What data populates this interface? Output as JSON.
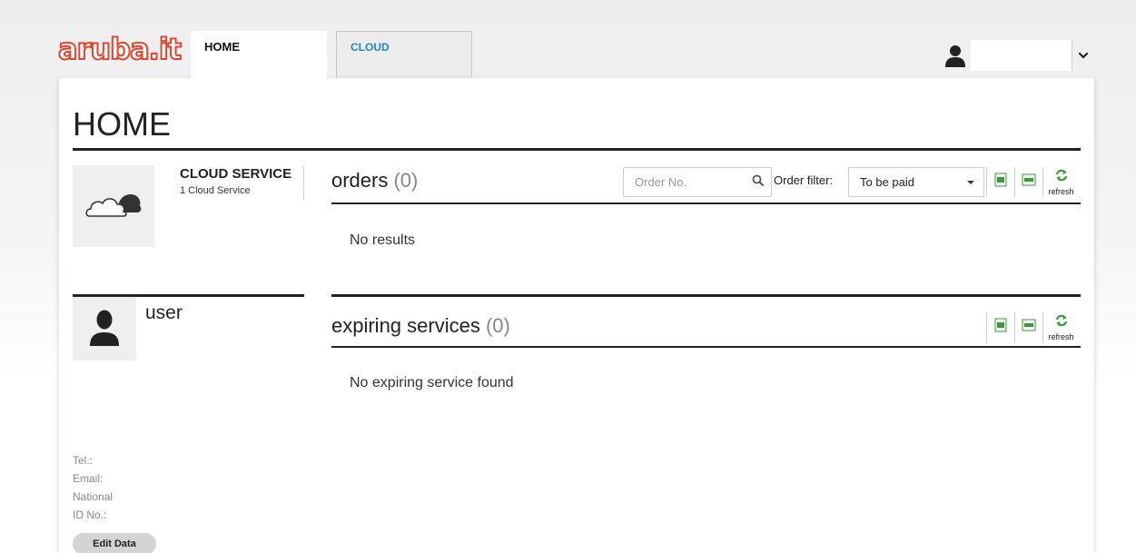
{
  "brand": {
    "logo_text": "aruba.it",
    "logo_color": "#e0452d"
  },
  "tabs": [
    {
      "label": "HOME",
      "active": true
    },
    {
      "label": "CLOUD",
      "active": false
    }
  ],
  "header": {
    "user_icon": "user-icon",
    "dropdown_icon": "chevron-down-icon"
  },
  "page": {
    "title": "HOME"
  },
  "cloud_service": {
    "name": "CLOUD SERVICE",
    "count_label": "1 Cloud Service",
    "icon": "cloud-icon"
  },
  "orders": {
    "title": "orders",
    "count": "(0)",
    "search_placeholder": "Order No.",
    "filter_label": "Order filter:",
    "filter_value": "To be paid",
    "refresh_label": "refresh",
    "empty_message": "No results"
  },
  "user_card": {
    "label": "user",
    "icon": "user-avatar-icon"
  },
  "expiring_services": {
    "title": "expiring services",
    "count": "(0)",
    "refresh_label": "refresh",
    "empty_message": "No expiring service found"
  },
  "contact": {
    "tel_label": "Tel.:",
    "email_label": "Email:",
    "national_label": "National",
    "id_label": "ID No.:"
  },
  "edit_button_label": "Edit Data",
  "colors": {
    "accent_blue": "#1e88c8",
    "export_green": "#3a9a3a"
  }
}
